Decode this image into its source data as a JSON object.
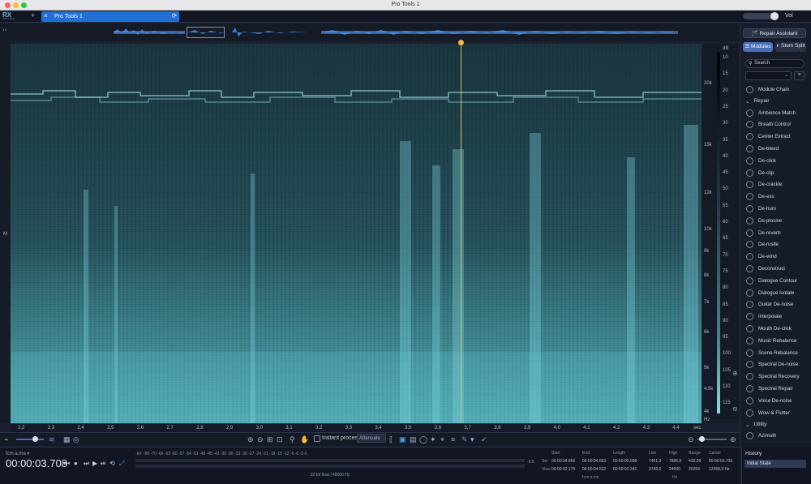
{
  "window": {
    "title": "Pro Tools 1"
  },
  "logo": {
    "text": "RX",
    "sub": "Audio Editor"
  },
  "tab": {
    "label": "Pro Tools 1",
    "add": "+",
    "close": "×"
  },
  "volume": {
    "label": "Vol",
    "level": 0.8
  },
  "right_panel": {
    "repair_assistant": "Repair Assistant",
    "modules_tab": "Modules",
    "stem_split": "Stem Split",
    "search_placeholder": "Search",
    "module_chain": "Module Chain",
    "sections": [
      {
        "label": "Repair"
      },
      {
        "label": "Utility"
      }
    ],
    "repair_items": [
      "Ambience Match",
      "Breath Control",
      "Center Extract",
      "De-bleed",
      "De-click",
      "De-clip",
      "De-crackle",
      "De-ess",
      "De-hum",
      "De-plosive",
      "De-reverb",
      "De-rustle",
      "De-wind",
      "Deconstruct",
      "Dialogue Contour",
      "Dialogue Isolate",
      "Guitar De-noise",
      "Interpolate",
      "Mouth De-click",
      "Music Rebalance",
      "Scene Rebalance",
      "Spectral De-noise",
      "Spectral Recovery",
      "Spectral Repair",
      "Voice De-noise",
      "Wow & Flutter"
    ],
    "utility_items": [
      "Azimuth"
    ]
  },
  "scale": {
    "db_label": "dB",
    "db_ticks": [
      "10",
      "15",
      "20",
      "25",
      "30",
      "35",
      "40",
      "45",
      "50",
      "55",
      "60",
      "65",
      "70",
      "75",
      "80",
      "85",
      "90",
      "95",
      "100",
      "105",
      "110",
      "115"
    ],
    "hz_ticks": [
      "20k",
      "15k",
      "12k",
      "10k",
      "9k",
      "8k",
      "7k",
      "6k",
      "5k",
      "4,5k",
      "4k"
    ],
    "hz_unit": "Hz"
  },
  "side": {
    "marker": "M"
  },
  "timeline": {
    "ticks": [
      "2,2",
      "2,3",
      "2,4",
      "2,5",
      "2,6",
      "2,7",
      "2,8",
      "2,9",
      "3,0",
      "3,1",
      "3,2",
      "3,3",
      "3,4",
      "3,5",
      "3,6",
      "3,7",
      "3,8",
      "3,9",
      "4,0",
      "4,1",
      "4,2",
      "4,3",
      "4,4"
    ],
    "unit": "sec"
  },
  "toolbar": {
    "instant_process": "Instant process",
    "attenuate": "Attenuate"
  },
  "transport": {
    "file": "fcm:a.ma",
    "timecode": "00:00:03.708",
    "meter_scale": "-Inf. -80   -70   -66   -63   -60   -57   -54   -51   -48   -45   -42   -39   -36   -33   -30   -27   -24   -21   -18   -15   -12   -9   -6   -3   0",
    "meter_max": "-5.5",
    "format": "32-bit float | 48000 Hz"
  },
  "selection": {
    "headers": [
      "Start",
      "End",
      "Length",
      "Low",
      "High",
      "Range",
      "Cursor"
    ],
    "sel_label": "Sel",
    "view_label": "View",
    "sel": [
      "00:00:04.655",
      "00:00:04.663",
      "00:00:00.008",
      "7451,9",
      "7885,0",
      "433,09",
      "00:00:03.739"
    ],
    "view": [
      "00:00:02.179",
      "00:00:04.522",
      "00:00:02.342",
      "3745,6",
      "24000",
      "20254",
      "12458,9 Hz"
    ],
    "time_unit": "h:m:s.ms",
    "hz_unit": "Hz"
  },
  "history": {
    "title": "History",
    "items": [
      "Initial State"
    ]
  },
  "colors": {
    "accent": "#1f6fd6",
    "cursor": "#f0b93a",
    "spectrogram": "#3b8890"
  }
}
